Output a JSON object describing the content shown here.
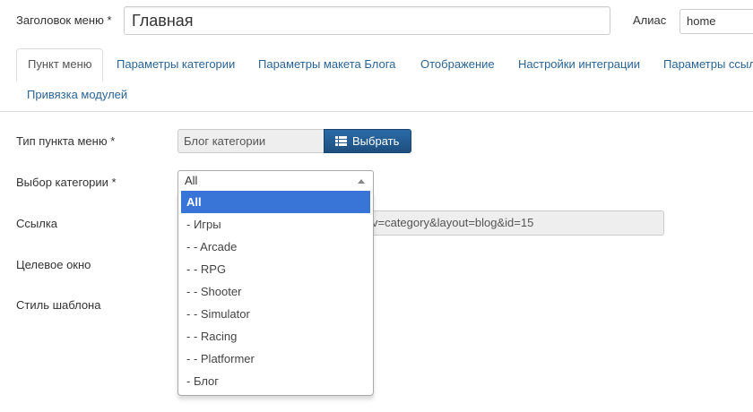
{
  "header": {
    "menu_title_label": "Заголовок меню *",
    "menu_title_value": "Главная",
    "alias_label": "Алиас",
    "alias_value": "home"
  },
  "tabs": [
    {
      "label": "Пункт меню",
      "active": true
    },
    {
      "label": "Параметры категории"
    },
    {
      "label": "Параметры макета Блога"
    },
    {
      "label": "Отображение"
    },
    {
      "label": "Настройки интеграции"
    },
    {
      "label": "Параметры ссыл"
    },
    {
      "label": "Привязка модулей"
    }
  ],
  "form": {
    "menu_item_type_label": "Тип пункта меню *",
    "menu_item_type_value": "Блог категории",
    "select_button_label": "Выбрать",
    "category_label": "Выбор категории *",
    "category_value": "All",
    "link_label": "Ссылка",
    "link_value_visible": "v=category&layout=blog&id=15",
    "target_window_label": "Целевое окно",
    "template_style_label": "Стиль шаблона"
  },
  "dropdown": {
    "options": [
      "All",
      "- Игры",
      "- - Arcade",
      "- - RPG",
      "- - Shooter",
      "- - Simulator",
      "- - Racing",
      "- - Platformer",
      "- Блог"
    ],
    "highlighted_index": 0
  },
  "colors": {
    "link": "#2a6496",
    "primary_button": "#2b6aa6",
    "dropdown_highlight": "#3875d7"
  }
}
